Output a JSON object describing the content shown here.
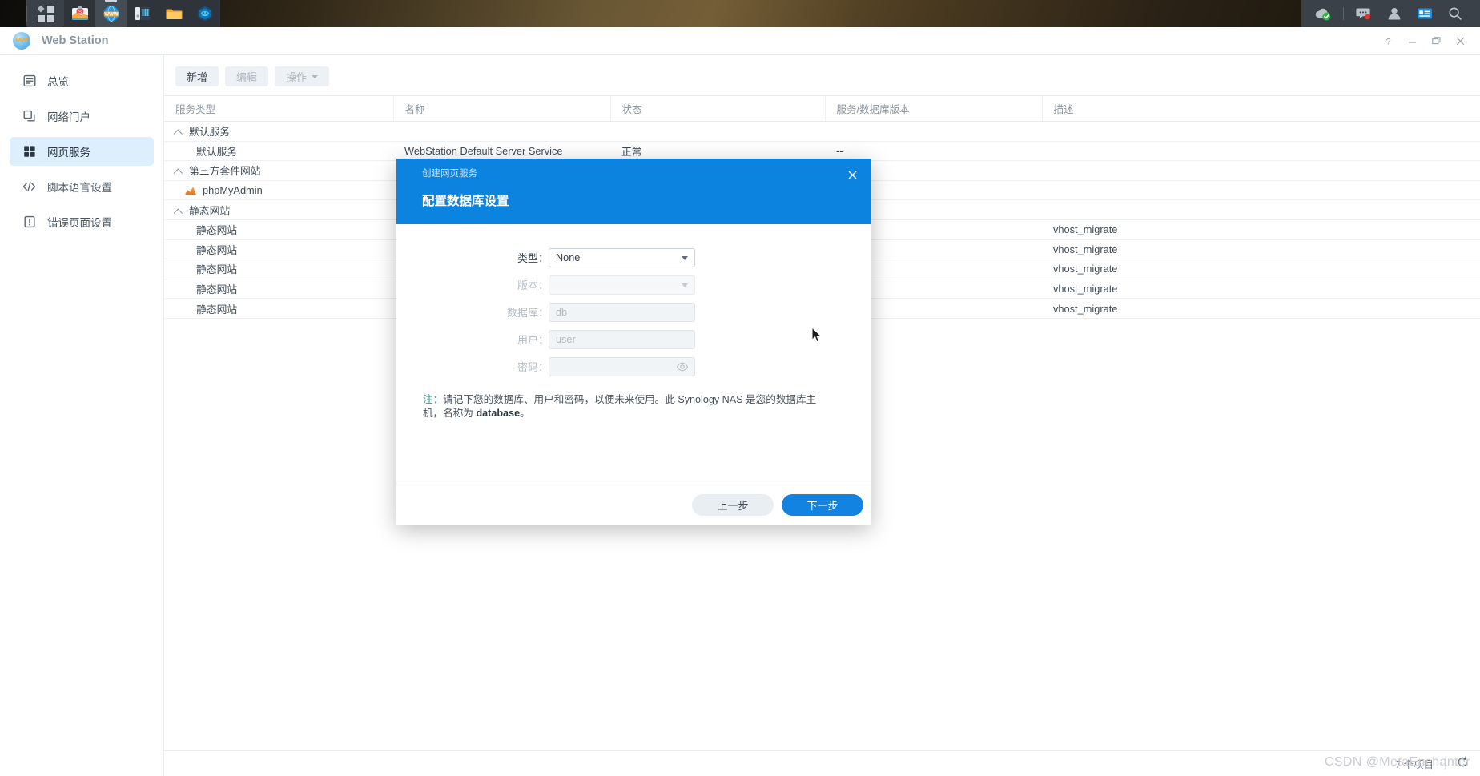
{
  "taskbar": {
    "menu_icon": "app-grid-icon",
    "apps": [
      {
        "name": "package-center-icon",
        "label": "Package Center"
      },
      {
        "name": "web-station-icon",
        "label": "Web Station",
        "active": true
      },
      {
        "name": "storage-manager-icon",
        "label": "Storage Manager"
      },
      {
        "name": "file-station-icon",
        "label": "File Station"
      },
      {
        "name": "container-manager-icon",
        "label": "Container Manager"
      }
    ],
    "right_icons": [
      {
        "name": "upload-status-icon",
        "label": "Background tasks"
      },
      {
        "name": "notifications-icon",
        "label": "Notifications",
        "badge": true
      },
      {
        "name": "user-account-icon",
        "label": "Account"
      },
      {
        "name": "widgets-icon",
        "label": "Widgets"
      },
      {
        "name": "search-icon",
        "label": "Search"
      }
    ]
  },
  "window": {
    "title": "Web Station",
    "help_label": "?",
    "minimize_label": "–",
    "restore_label": "❐",
    "close_label": "✕"
  },
  "sidebar": {
    "items": [
      {
        "label": "总览",
        "icon": "overview-icon",
        "active": false
      },
      {
        "label": "网络门户",
        "icon": "web-portal-icon",
        "active": false
      },
      {
        "label": "网页服务",
        "icon": "web-service-icon",
        "active": true
      },
      {
        "label": "脚本语言设置",
        "icon": "script-language-icon",
        "active": false
      },
      {
        "label": "错误页面设置",
        "icon": "error-page-icon",
        "active": false
      }
    ]
  },
  "toolbar": {
    "add_label": "新增",
    "edit_label": "编辑",
    "action_label": "操作"
  },
  "table": {
    "columns": [
      "服务类型",
      "名称",
      "状态",
      "服务/数据库版本",
      "描述"
    ],
    "groups": [
      {
        "label": "默认服务",
        "rows": [
          {
            "type": "默认服务",
            "name": "WebStation Default Server Service",
            "status": "正常",
            "version": "--",
            "desc": ""
          }
        ]
      },
      {
        "label": "第三方套件网站",
        "rows": [
          {
            "type": "phpMyAdmin",
            "name": "",
            "status": "",
            "version": "",
            "desc": "",
            "icon": "phpmyadmin-icon"
          }
        ]
      },
      {
        "label": "静态网站",
        "rows": [
          {
            "type": "静态网站",
            "name": "",
            "status": "",
            "version": "",
            "desc": "vhost_migrate"
          },
          {
            "type": "静态网站",
            "name": "",
            "status": "",
            "version": "",
            "desc": "vhost_migrate"
          },
          {
            "type": "静态网站",
            "name": "",
            "status": "",
            "version": "",
            "desc": "vhost_migrate"
          },
          {
            "type": "静态网站",
            "name": "",
            "status": "",
            "version": "",
            "desc": "vhost_migrate"
          },
          {
            "type": "静态网站",
            "name": "",
            "status": "",
            "version": "",
            "desc": "vhost_migrate"
          }
        ]
      }
    ]
  },
  "statusbar": {
    "count_label": "7 个项目",
    "refresh_icon": "refresh-icon"
  },
  "modal": {
    "step_label": "创建网页服务",
    "title": "配置数据库设置",
    "close_label": "✕",
    "fields": [
      {
        "key": "type",
        "label": "类型：",
        "control": "select",
        "value": "None",
        "disabled": false
      },
      {
        "key": "version",
        "label": "版本：",
        "control": "select",
        "value": "",
        "disabled": true
      },
      {
        "key": "database",
        "label": "数据库：",
        "control": "input",
        "value": "",
        "placeholder": "db",
        "disabled": true
      },
      {
        "key": "user",
        "label": "用户：",
        "control": "input",
        "value": "",
        "placeholder": "user",
        "disabled": true
      },
      {
        "key": "password",
        "label": "密码：",
        "control": "password",
        "value": "",
        "placeholder": "",
        "disabled": true
      }
    ],
    "note_prefix": "注：",
    "note_text": "请记下您的数据库、用户和密码，以便未来使用。此 Synology NAS 是您的数据库主机，名称为 ",
    "note_bold": "database",
    "note_suffix": "。",
    "back_label": "上一步",
    "next_label": "下一步"
  },
  "watermark": {
    "text": "CSDN @MetaEnchanter"
  },
  "colors": {
    "accent": "#0d83e0",
    "primary_button": "#1383e2",
    "sidebar_active": "#ddeefc",
    "status_ok": "#35a332",
    "note_keyword": "#17a3a0"
  }
}
